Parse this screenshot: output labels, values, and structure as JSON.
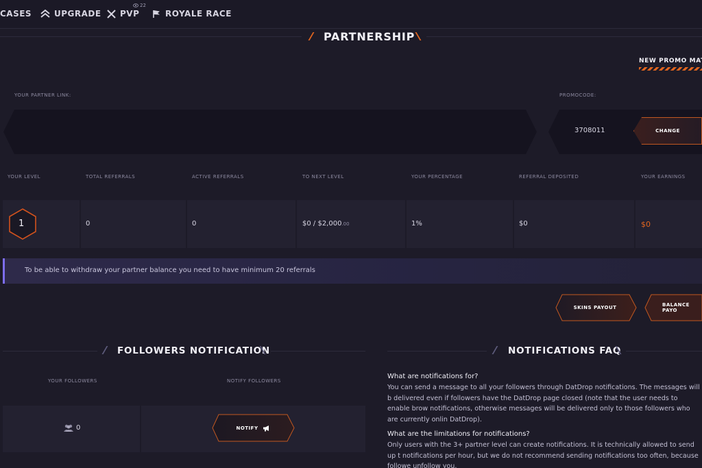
{
  "nav": {
    "items": [
      {
        "label": "CASES",
        "icon": "cases-icon"
      },
      {
        "label": "UPGRADE",
        "icon": "upgrade-chevrons-icon"
      },
      {
        "label": "PVP",
        "icon": "crossed-swords-icon"
      },
      {
        "label": "ROYALE RACE",
        "icon": "flag-icon"
      }
    ],
    "pvp_viewers": "22"
  },
  "partnership": {
    "title": "PARTNERSHIP",
    "promo_materials_label": "NEW PROMO MATE",
    "partner_link_label": "YOUR PARTNER LINK:",
    "partner_link_value": "",
    "promocode_label": "PROMOCODE:",
    "promocode_value": "3708011",
    "change_label": "CHANGE"
  },
  "stats": {
    "headers": [
      "YOUR LEVEL",
      "TOTAL REFERRALS",
      "ACTIVE REFERRALS",
      "TO NEXT LEVEL",
      "YOUR PERCENTAGE",
      "REFERRAL DEPOSITED",
      "YOUR EARNINGS"
    ],
    "level": "1",
    "total_referrals": "0",
    "active_referrals": "0",
    "to_next_level": "$0 / $2,000",
    "to_next_level_cents": ".00",
    "percentage": "1%",
    "referral_deposited": "$0",
    "earnings": "$0"
  },
  "info": {
    "withdraw_notice": "To be able to withdraw your partner balance you need to have minimum 20 referrals"
  },
  "payout": {
    "skins_label": "SKINS PAYOUT",
    "balance_label": "BALANCE PAYO"
  },
  "followers": {
    "title": "FOLLOWERS NOTIFICATION",
    "your_followers_label": "YOUR FOLLOWERS",
    "notify_followers_label": "NOTIFY FOLLOWERS",
    "count": "0",
    "notify_label": "NOTIFY"
  },
  "faq": {
    "title": "NOTIFICATIONS FAQ",
    "q1": "What are notifications for?",
    "a1": "You can send a message to all your followers through DatDrop notifications. The messages will b delivered even if followers have the DatDrop page closed (note that the user needs to enable brow notifications, otherwise messages will be delivered only to those followers who are currently onlin DatDrop).",
    "q2": "What are the limitations for notifications?",
    "a2": "Only users with the 3+ partner level can create notifications. It is technically allowed to send up t notifications per hour, but we do not recommend sending notifications too often, because followe unfollow you."
  },
  "colors": {
    "accent": "#e1651f",
    "earnings": "#e1651f",
    "info_bar_accent": "#7d6df0",
    "background": "#1d1b28"
  }
}
